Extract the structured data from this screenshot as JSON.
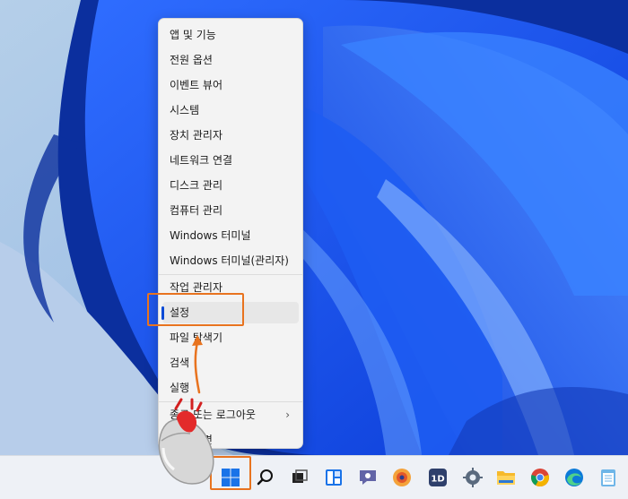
{
  "context_menu": {
    "items": [
      {
        "label": "앱 및 기능"
      },
      {
        "label": "전원 옵션"
      },
      {
        "label": "이벤트 뷰어"
      },
      {
        "label": "시스템"
      },
      {
        "label": "장치 관리자"
      },
      {
        "label": "네트워크 연결"
      },
      {
        "label": "디스크 관리"
      },
      {
        "label": "컴퓨터 관리"
      },
      {
        "label": "Windows 터미널"
      },
      {
        "label": "Windows 터미널(관리자)"
      },
      {
        "label": "작업 관리자"
      },
      {
        "label": "설정",
        "highlighted": true
      },
      {
        "label": "파일 탐색기"
      },
      {
        "label": "검색"
      },
      {
        "label": "실행"
      },
      {
        "label": "종료 또는 로그아웃",
        "submenu": true
      },
      {
        "label": "바탕 화면"
      }
    ]
  },
  "taskbar": {
    "icons": [
      "windows-start-icon",
      "search-icon",
      "task-view-icon",
      "widgets-icon",
      "teams-chat-icon",
      "media-player-icon",
      "app-1d-icon",
      "settings-gear-icon",
      "file-explorer-icon",
      "chrome-icon",
      "edge-icon",
      "notepad-icon"
    ]
  },
  "colors": {
    "highlight_box": "#e8731f",
    "accent": "#0a4ad6",
    "menu_bg": "#f3f3f3",
    "taskbar_bg": "#eef1f6"
  }
}
